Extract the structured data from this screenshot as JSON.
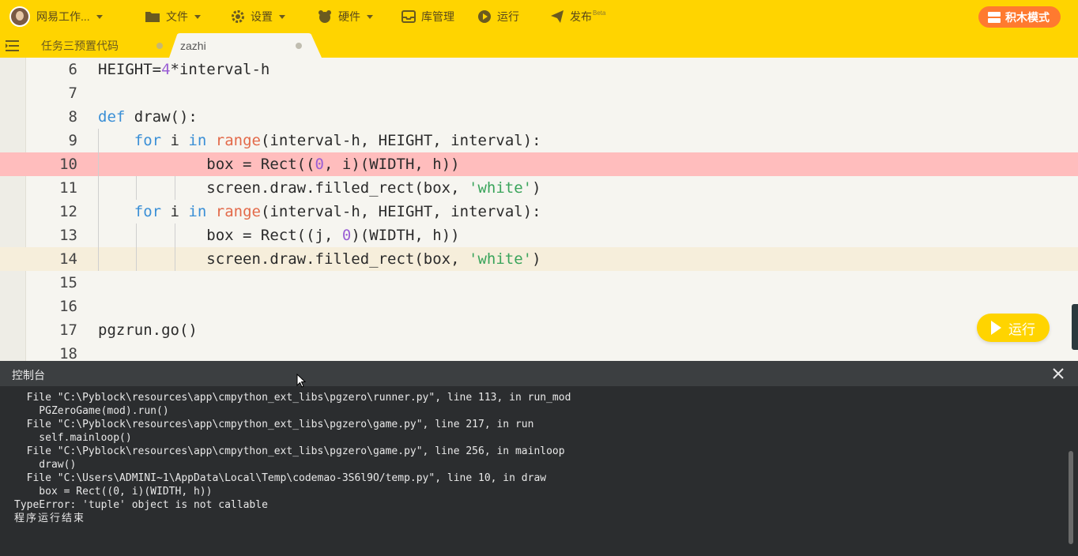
{
  "topbar": {
    "user_name": "网易工作...",
    "menu": {
      "file": "文件",
      "settings": "设置",
      "hardware": "硬件",
      "library": "库管理",
      "run": "运行",
      "publish": "发布"
    },
    "publish_badge": "Beta",
    "mode_button": "积木模式",
    "colors": {
      "bar": "#ffd400",
      "mode_button": "#ff7a2f"
    }
  },
  "tabs": [
    {
      "label": "任务三预置代码",
      "active": false
    },
    {
      "label": "zazhi",
      "active": true
    }
  ],
  "editor": {
    "lines": [
      {
        "num": "6",
        "code": "HEIGHT=4*interval-h"
      },
      {
        "num": "7",
        "code": ""
      },
      {
        "num": "8",
        "code": "def draw():"
      },
      {
        "num": "9",
        "code": "    for i in range(interval-h, HEIGHT, interval):"
      },
      {
        "num": "10",
        "code": "            box = Rect((0, i)(WIDTH, h))",
        "highlight": "error"
      },
      {
        "num": "11",
        "code": "            screen.draw.filled_rect(box, 'white')"
      },
      {
        "num": "12",
        "code": "    for i in range(interval-h, HEIGHT, interval):"
      },
      {
        "num": "13",
        "code": "            box = Rect((j, 0)(WIDTH, h))"
      },
      {
        "num": "14",
        "code": "            screen.draw.filled_rect(box, 'white')",
        "highlight": "current"
      },
      {
        "num": "15",
        "code": ""
      },
      {
        "num": "16",
        "code": ""
      },
      {
        "num": "17",
        "code": "pgzrun.go()"
      },
      {
        "num": "18",
        "code": ""
      }
    ],
    "run_button": "运行",
    "colors": {
      "error_line": "#ffbdbd",
      "keyword": "#3a8fd6",
      "builtin": "#e36a4a",
      "number": "#9a5fd4",
      "string": "#3aa45b"
    }
  },
  "console": {
    "title": "控制台",
    "lines": [
      "  File \"C:\\Pyblock\\resources\\app\\cmpython_ext_libs\\pgzero\\runner.py\", line 113, in run_mod",
      "    PGZeroGame(mod).run()",
      "  File \"C:\\Pyblock\\resources\\app\\cmpython_ext_libs\\pgzero\\game.py\", line 217, in run",
      "    self.mainloop()",
      "  File \"C:\\Pyblock\\resources\\app\\cmpython_ext_libs\\pgzero\\game.py\", line 256, in mainloop",
      "    draw()",
      "  File \"C:\\Users\\ADMINI~1\\AppData\\Local\\Temp\\codemao-3S6l9O/temp.py\", line 10, in draw",
      "    box = Rect((0, i)(WIDTH, h))",
      "TypeError: 'tuple' object is not callable",
      "程序运行结束"
    ]
  }
}
